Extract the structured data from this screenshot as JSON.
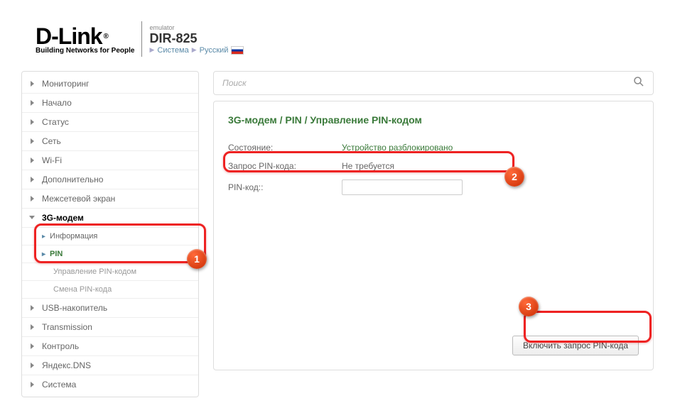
{
  "header": {
    "logo_main": "D-Link",
    "logo_sub": "Building Networks for People",
    "emulator_label": "emulator",
    "model": "DIR-825",
    "crumb_system": "Система",
    "crumb_lang": "Русский"
  },
  "sidebar": {
    "items": [
      {
        "label": "Мониторинг"
      },
      {
        "label": "Начало"
      },
      {
        "label": "Статус"
      },
      {
        "label": "Сеть"
      },
      {
        "label": "Wi-Fi"
      },
      {
        "label": "Дополнительно"
      },
      {
        "label": "Межсетевой экран"
      },
      {
        "label": "3G-модем"
      },
      {
        "label": "Информация"
      },
      {
        "label": "PIN"
      },
      {
        "label": "Управление PIN-кодом"
      },
      {
        "label": "Смена PIN-кода"
      },
      {
        "label": "USB-накопитель"
      },
      {
        "label": "Transmission"
      },
      {
        "label": "Контроль"
      },
      {
        "label": "Яндекс.DNS"
      },
      {
        "label": "Система"
      }
    ]
  },
  "search": {
    "placeholder": "Поиск"
  },
  "page": {
    "breadcrumb": "3G-модем /  PIN /  Управление PIN-кодом",
    "rows": {
      "state_label": "Состояние:",
      "state_value": "Устройство разблокировано",
      "pinreq_label": "Запрос PIN-кода:",
      "pinreq_value": "Не требуется",
      "pincode_label": "PIN-код::"
    },
    "action_button": "Включить запрос PIN-кода"
  },
  "annotations": {
    "n1": "1",
    "n2": "2",
    "n3": "3"
  }
}
